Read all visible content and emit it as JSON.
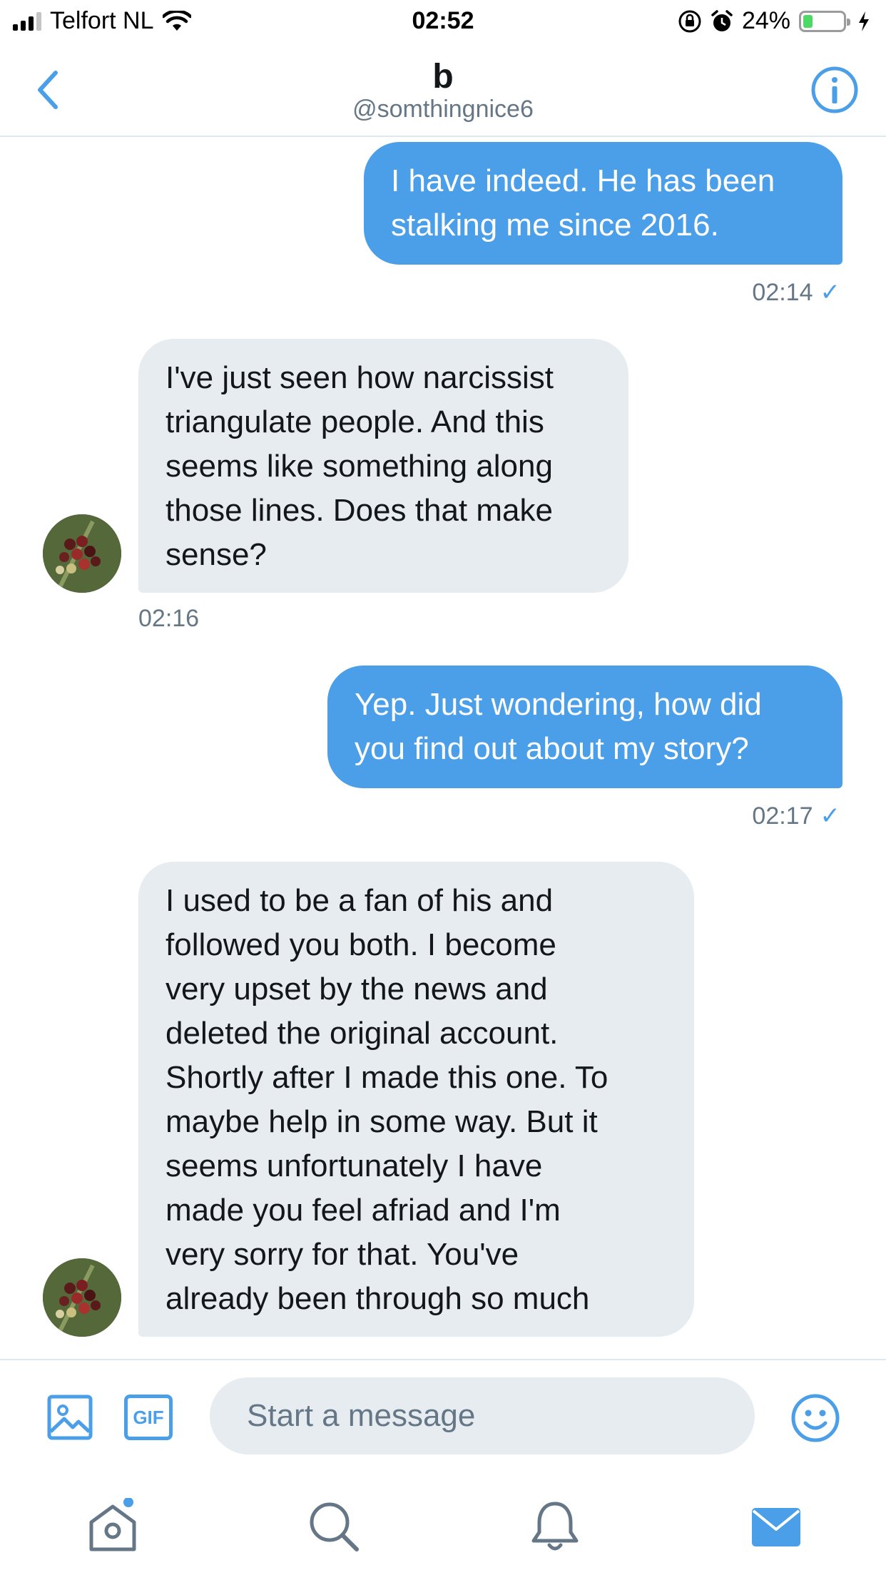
{
  "status_bar": {
    "carrier": "Telfort NL",
    "time": "02:52",
    "battery": "24%",
    "battery_level": 0.24
  },
  "header": {
    "title": "b",
    "handle": "@somthingnice6"
  },
  "messages": [
    {
      "direction": "out",
      "text": "I have indeed. He has been\nstalking me since 2016.",
      "time": "02:14",
      "read": true
    },
    {
      "direction": "in",
      "text": "I've just seen how narcissist\ntriangulate people. And this\nseems like something along\nthose lines. Does that make\nsense?",
      "time": "02:16"
    },
    {
      "direction": "out",
      "text": "Yep. Just wondering, how did\nyou find out about my story?",
      "time": "02:17",
      "read": true
    },
    {
      "direction": "in",
      "text": "I used to be a fan of his and\nfollowed you both. I become\nvery upset by the news and\ndeleted the original account.\nShortly after I made this one. To\nmaybe help in some way. But it\nseems  unfortunately I have\nmade you feel afriad and I'm\nvery sorry for that. You've\nalready been through so much"
    }
  ],
  "compose": {
    "placeholder": "Start a message",
    "gif_label": "GIF"
  },
  "colors": {
    "accent": "#4a9fe8",
    "incoming_bubble": "#e6ecf0",
    "secondary_text": "#657786"
  },
  "icons": [
    "back-chevron-icon",
    "info-icon",
    "image-icon",
    "gif-icon",
    "emoji-icon",
    "home-icon",
    "search-icon",
    "bell-icon",
    "mail-icon"
  ]
}
